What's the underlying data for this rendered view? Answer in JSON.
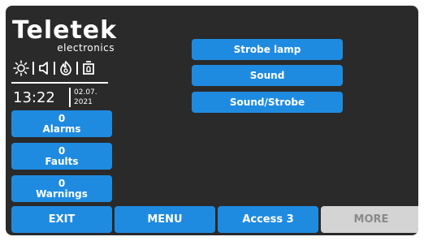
{
  "logo": {
    "brand": "Teletek",
    "sub": "electronics"
  },
  "status_icons": [
    "sun-icon",
    "speaker-icon",
    "flame-icon",
    "alarm-bell-icon"
  ],
  "clock": {
    "time": "13:22",
    "date_day_month": "02.07.",
    "date_year": "2021"
  },
  "counters": [
    {
      "count": "0",
      "label": "Alarms"
    },
    {
      "count": "0",
      "label": "Faults"
    },
    {
      "count": "0",
      "label": "Warnings"
    }
  ],
  "options": [
    {
      "label": "Strobe lamp"
    },
    {
      "label": "Sound"
    },
    {
      "label": "Sound/Strobe"
    }
  ],
  "bottom": {
    "exit": "EXIT",
    "menu": "MENU",
    "access": "Access 3",
    "more": "MORE"
  },
  "colors": {
    "background": "#2a2a2a",
    "button": "#1f8be0",
    "disabled_button": "#d4d4d4",
    "disabled_text": "#8a8a8a"
  }
}
